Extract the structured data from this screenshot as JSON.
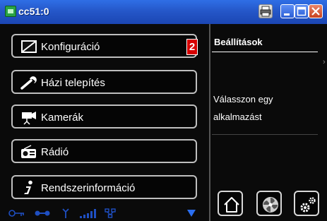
{
  "window": {
    "title": "cc51:0",
    "icons": [
      "app-icon",
      "print-icon",
      "minimize-icon",
      "maximize-icon",
      "close-icon"
    ]
  },
  "menu": {
    "items": [
      {
        "label": "Konfiguráció",
        "icon": "config-icon",
        "badge": "2"
      },
      {
        "label": "Házi telepítés",
        "icon": "wrench-icon"
      },
      {
        "label": "Kamerák",
        "icon": "camera-icon"
      },
      {
        "label": "Rádió",
        "icon": "radio-icon"
      },
      {
        "label": "Rendszerinformáció",
        "icon": "info-icon"
      }
    ]
  },
  "panel": {
    "title": "Beállítások",
    "message": "Válasszon egy alkalmazást"
  },
  "bottom_buttons": [
    "home-icon",
    "fan-icon",
    "settings-gear-icon"
  ],
  "status_icons": [
    "key-icon",
    "link-icon",
    "antenna-icon",
    "signal-bars-icon",
    "network-icon",
    "scroll-down-icon"
  ],
  "colors": {
    "titlebar": "#2557c9",
    "badge": "#d60000",
    "status": "#1f4fc2"
  }
}
